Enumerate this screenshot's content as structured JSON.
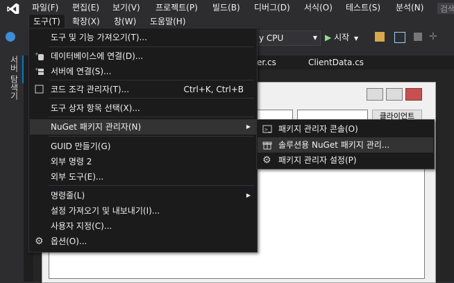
{
  "menubar": {
    "items": [
      "파일(F)",
      "편집(E)",
      "보기(V)",
      "프로젝트(P)",
      "빌드(B)",
      "디버그(D)",
      "서식(O)",
      "테스트(S)",
      "분석(N)"
    ],
    "row2": [
      "도구(T)",
      "확장(X)",
      "창(W)",
      "도움말(H)"
    ],
    "search_placeholder": "검색"
  },
  "toolbar": {
    "platform": "y CPU",
    "start_label": "시작"
  },
  "left_panel": {
    "server_explorer": "서버 탐색기"
  },
  "doc_tabs": [
    "er.cs",
    "ClientData.cs"
  ],
  "form": {
    "button_label": "클라이언트"
  },
  "tools_menu": {
    "items": [
      {
        "label": "도구 및 기능 가져오기(T)...",
        "shortcut": "",
        "icon": ""
      },
      {
        "label": "데이터베이스에 연결(D)...",
        "shortcut": "",
        "icon": "database-connect-icon"
      },
      {
        "label": "서버에 연결(S)...",
        "shortcut": "",
        "icon": "server-connect-icon"
      },
      {
        "label": "코드 조각 관리자(T)...",
        "shortcut": "Ctrl+K, Ctrl+B",
        "icon": "checkbox-icon"
      },
      {
        "label": "도구 상자 항목 선택(X)...",
        "shortcut": "",
        "icon": ""
      },
      {
        "label": "NuGet 패키지 관리자(N)",
        "shortcut": "",
        "icon": "",
        "submenu": true
      },
      {
        "label": "GUID 만들기(G)",
        "shortcut": "",
        "icon": ""
      },
      {
        "label": "외부 명령 2",
        "shortcut": "",
        "icon": ""
      },
      {
        "label": "외부 도구(E)...",
        "shortcut": "",
        "icon": ""
      },
      {
        "label": "명령줄(L)",
        "shortcut": "",
        "icon": "",
        "submenu": true
      },
      {
        "label": "설정 가져오기 및 내보내기(I)...",
        "shortcut": "",
        "icon": ""
      },
      {
        "label": "사용자 지정(C)...",
        "shortcut": "",
        "icon": ""
      },
      {
        "label": "옵션(O)...",
        "shortcut": "",
        "icon": "gear-icon"
      }
    ]
  },
  "nuget_submenu": {
    "items": [
      {
        "label": "패키지 관리자 콘솔(O)",
        "icon": "console-icon"
      },
      {
        "label": "솔루션용 NuGet 패키지 관리...",
        "icon": "package-icon"
      },
      {
        "label": "패키지 관리자 설정(P)",
        "icon": "gear-icon"
      }
    ]
  },
  "colors": {
    "accent": "#68217a",
    "menu_bg": "#1b1b1c",
    "highlight": "#333334",
    "start_green": "#8ae28a"
  }
}
